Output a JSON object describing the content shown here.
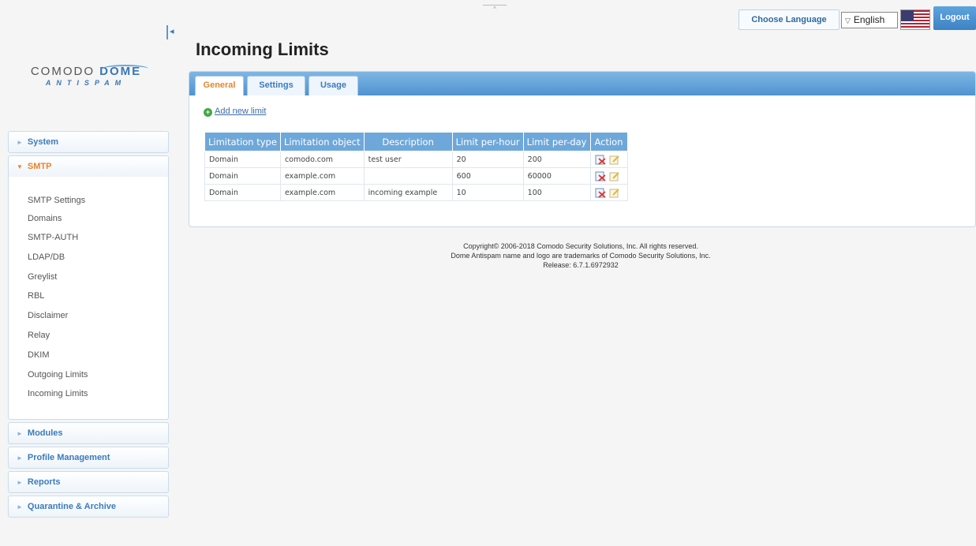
{
  "header": {
    "choose_language": "Choose Language",
    "language_selected": "English",
    "logout": "Logout",
    "flag_icon": "us-flag-icon"
  },
  "logo": {
    "line1_a": "COMODO",
    "line1_b": "DOME",
    "line2": "ANTISPAM"
  },
  "sidebar": {
    "system": "System",
    "smtp": "SMTP",
    "smtp_items": [
      "SMTP Settings",
      "Domains",
      "SMTP-AUTH",
      "LDAP/DB",
      "Greylist",
      "RBL",
      "Disclaimer",
      "Relay",
      "DKIM",
      "Outgoing Limits",
      "Incoming Limits"
    ],
    "modules": "Modules",
    "profile_management": "Profile Management",
    "reports": "Reports",
    "quarantine": "Quarantine & Archive"
  },
  "main": {
    "title": "Incoming Limits",
    "tabs": [
      "General",
      "Settings",
      "Usage"
    ],
    "active_tab": "General",
    "add_new_limit": "Add new limit",
    "table": {
      "headers": [
        "Limitation type",
        "Limitation object",
        "Description",
        "Limit per-hour",
        "Limit per-day",
        "Action"
      ],
      "rows": [
        [
          "Domain",
          "comodo.com",
          "test user",
          "20",
          "200"
        ],
        [
          "Domain",
          "example.com",
          "",
          "600",
          "60000"
        ],
        [
          "Domain",
          "example.com",
          "incoming example",
          "10",
          "100"
        ]
      ]
    }
  },
  "footer": {
    "line1": "Copyright© 2006-2018 Comodo Security Solutions, Inc. All rights reserved.",
    "line2": "Dome Antispam name and logo are trademarks of Comodo Security Solutions, Inc.",
    "line3": "Release: 6.7.1.6972932"
  },
  "colors": {
    "accent_blue": "#3b7bbd",
    "accent_orange": "#e8852a",
    "table_header": "#6ea8da"
  }
}
